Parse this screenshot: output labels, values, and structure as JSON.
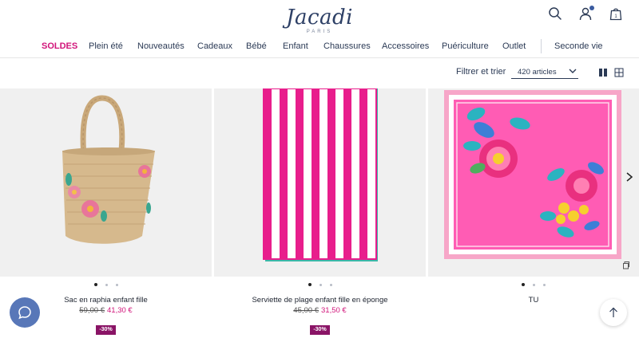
{
  "brand": {
    "name": "Jacadi",
    "subtitle": "PARIS"
  },
  "header_icons": [
    "search-icon",
    "user-icon",
    "cart-icon"
  ],
  "cart": {
    "count": "1"
  },
  "nav": [
    "SOLDES",
    "Plein été",
    "Nouveautés",
    "Cadeaux",
    "Bébé",
    "Enfant",
    "Chaussures",
    "Accessoires",
    "Puériculture",
    "Outlet",
    "Seconde vie"
  ],
  "toolbar": {
    "filter_label": "Filtrer et trier",
    "count": "420 articles"
  },
  "products": [
    {
      "name": "Sac en raphia enfant fille",
      "old_price": "59,00 €",
      "new_price": "41,30 €",
      "discount": "-30%"
    },
    {
      "name": "Serviette de plage enfant fille en éponge",
      "old_price": "45,00 €",
      "new_price": "31,50 €",
      "discount": "-30%"
    },
    {
      "name": "TU"
    }
  ],
  "colors": {
    "accent": "#d1147a",
    "brand": "#2e4066",
    "badge": "#8a1466",
    "chat": "#5877b8"
  }
}
